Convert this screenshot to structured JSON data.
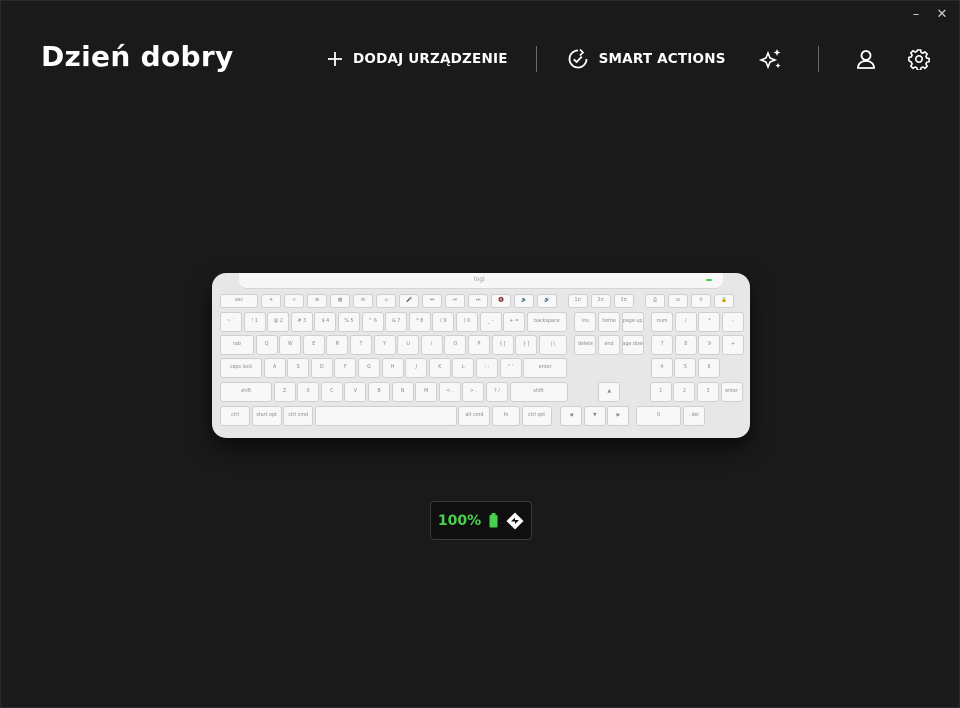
{
  "window": {
    "minimize_label": "–",
    "close_label": "✕"
  },
  "header": {
    "greeting": "Dzień dobry"
  },
  "nav": {
    "add_device": {
      "label": "DODAJ URZĄDZENIE",
      "icon": "plus-icon"
    },
    "smart_actions": {
      "label": "SMART ACTIONS",
      "icon": "smart-actions-icon"
    },
    "ai_prompt": {
      "icon": "sparkles-icon"
    },
    "account": {
      "icon": "user-icon"
    },
    "settings": {
      "icon": "gear-icon"
    }
  },
  "device": {
    "type": "keyboard",
    "brand_mark": "logi",
    "keys": [
      {
        "label": "esc",
        "width": 1.5,
        "row": 0
      },
      {
        "label": "☀",
        "row": 0
      },
      {
        "label": "☼",
        "row": 0
      },
      {
        "label": "⊞",
        "row": 0
      },
      {
        "label": "▦",
        "row": 0
      },
      {
        "label": "✉",
        "row": 0
      },
      {
        "label": "⌂",
        "row": 0
      },
      {
        "label": "🎤",
        "row": 0
      },
      {
        "label": "⏮",
        "row": 0
      },
      {
        "label": "⏯",
        "row": 0
      },
      {
        "label": "⏭",
        "row": 0
      },
      {
        "label": "🔇",
        "row": 0
      },
      {
        "label": "🔉",
        "row": 0
      },
      {
        "label": "🔊",
        "row": 0
      },
      {
        "label": "1⊏",
        "row": 0
      },
      {
        "label": "2⊏",
        "row": 0
      },
      {
        "label": "3⊏",
        "row": 0
      },
      {
        "label": "⎙",
        "row": 0
      },
      {
        "label": "⊡",
        "row": 0
      },
      {
        "label": "⚲",
        "row": 0
      },
      {
        "label": "🔒",
        "row": 0
      }
    ],
    "key_rows": {
      "row1": [
        "~ `",
        "! 1",
        "@ 2",
        "# 3",
        "$ 4",
        "% 5",
        "^ 6",
        "& 7",
        "* 8",
        "( 9",
        ") 0",
        "_ -",
        "+ =",
        "backspace",
        "ins",
        "home",
        "page up",
        "num",
        "/",
        "*",
        "-"
      ],
      "row2": [
        "tab",
        "Q",
        "W",
        "E",
        "R",
        "T",
        "Y",
        "U",
        "I",
        "O",
        "P",
        "{ [",
        "} ]",
        "| \\",
        "delete",
        "end",
        "page down",
        "7",
        "8",
        "9",
        "+"
      ],
      "row3": [
        "caps lock",
        "A",
        "S",
        "D",
        "F",
        "G",
        "H",
        "J",
        "K",
        "L",
        ": ;",
        "\" '",
        "enter",
        "4",
        "5",
        "6"
      ],
      "row4": [
        "shift",
        "Z",
        "X",
        "C",
        "V",
        "B",
        "N",
        "M",
        "< ,",
        "> .",
        "? /",
        "shift",
        "▲",
        "1",
        "2",
        "3",
        "enter"
      ],
      "row5": [
        "ctrl",
        "start opt",
        "ctrl cmd",
        "",
        "alt cmd",
        "fn",
        "ctrl opt",
        "◀",
        "▼",
        "▶",
        "0",
        ". del"
      ]
    }
  },
  "battery": {
    "percent": "100%",
    "level": 1.0,
    "charging_icon": "battery-icon",
    "connection_icon": "logi-bolt-icon",
    "color": "#47d14f"
  }
}
